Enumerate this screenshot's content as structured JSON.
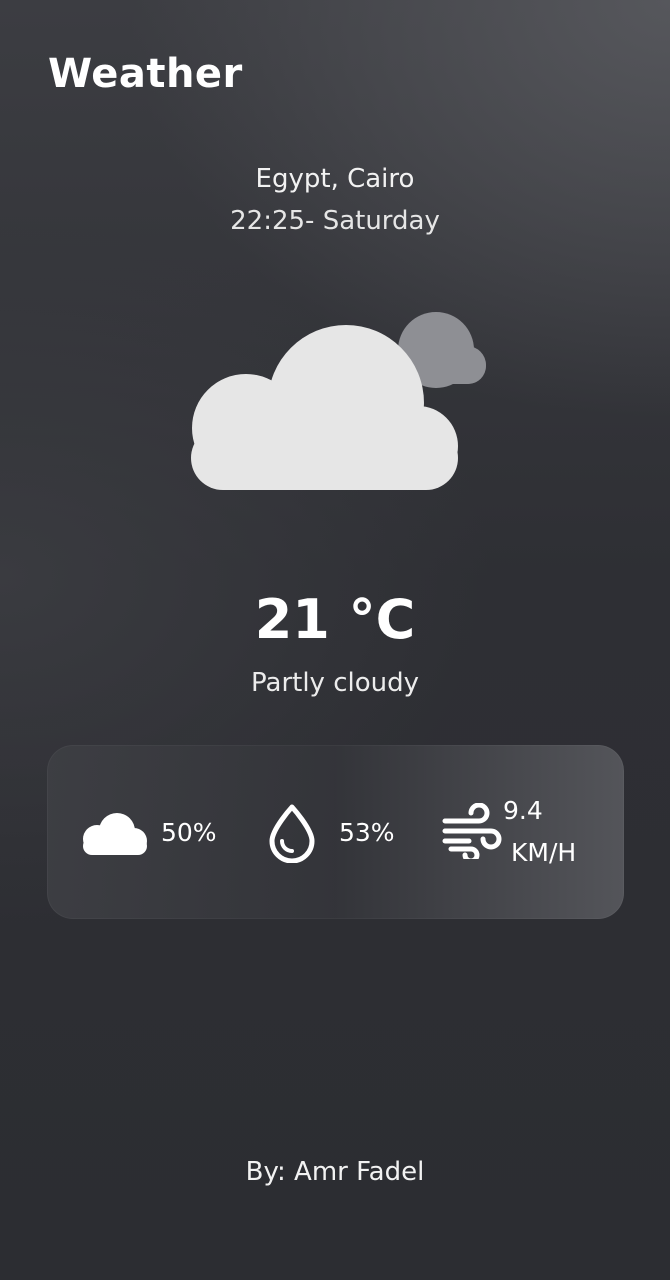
{
  "app": {
    "title": "Weather"
  },
  "location": {
    "place": "Egypt, Cairo",
    "datetime": "22:25- Saturday"
  },
  "current": {
    "icon": "partly-cloudy-icon",
    "temperature": "21 °C",
    "condition": "Partly cloudy"
  },
  "stats": {
    "cloud": {
      "icon": "cloud-icon",
      "value": "50%"
    },
    "humidity": {
      "icon": "water-drop-icon",
      "value": "53%"
    },
    "wind": {
      "icon": "wind-icon",
      "value_line1": "9.4",
      "value_line2": "KM/H"
    }
  },
  "footer": {
    "credit": "By: Amr Fadel"
  },
  "colors": {
    "background_top": "#3c3d42",
    "background_bottom": "#2c2d32",
    "cloud_front": "#e6e6e6",
    "cloud_back": "#8e8f94",
    "text": "#ffffff"
  }
}
